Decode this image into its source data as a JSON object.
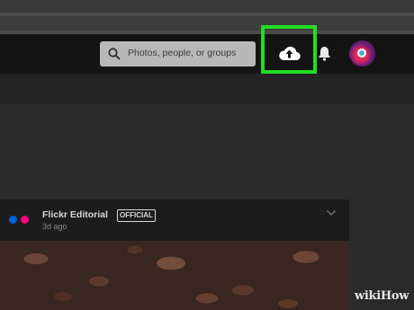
{
  "header": {
    "search": {
      "placeholder": "Photos, people, or groups"
    },
    "upload_icon": "cloud-upload-icon",
    "notifications_icon": "bell-icon",
    "colors": {
      "topbar": "#141414",
      "highlight": "#22dd22"
    }
  },
  "feed": {
    "post": {
      "author": "Flickr Editorial",
      "badge": "OFFICIAL",
      "time": "3d ago"
    }
  },
  "watermark": "wikiHow",
  "colors": {
    "flickr_blue": "#0063dc",
    "flickr_pink": "#ff0084"
  }
}
